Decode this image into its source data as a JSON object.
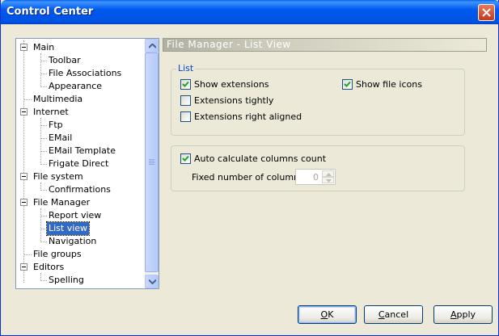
{
  "window": {
    "title": "Control Center"
  },
  "tree": {
    "items": [
      {
        "label": "Main",
        "level": 0,
        "expander": true
      },
      {
        "label": "Toolbar",
        "level": 1
      },
      {
        "label": "File Associations",
        "level": 1
      },
      {
        "label": "Appearance",
        "level": 1
      },
      {
        "label": "Multimedia",
        "level": 0
      },
      {
        "label": "Internet",
        "level": 0,
        "expander": true
      },
      {
        "label": "Ftp",
        "level": 1
      },
      {
        "label": "EMail",
        "level": 1
      },
      {
        "label": "EMail Template",
        "level": 1
      },
      {
        "label": "Frigate Direct",
        "level": 1
      },
      {
        "label": "File system",
        "level": 0,
        "expander": true
      },
      {
        "label": "Confirmations",
        "level": 1
      },
      {
        "label": "File Manager",
        "level": 0,
        "expander": true
      },
      {
        "label": "Report view",
        "level": 1
      },
      {
        "label": "List view",
        "level": 1,
        "selected": true
      },
      {
        "label": "Navigation",
        "level": 1
      },
      {
        "label": "File groups",
        "level": 0
      },
      {
        "label": "Editors",
        "level": 0,
        "expander": true
      },
      {
        "label": "Spelling",
        "level": 1
      }
    ]
  },
  "panel": {
    "header": "File Manager - List View",
    "list_group": {
      "caption": "List",
      "show_extensions": {
        "label": "Show extensions",
        "checked": true
      },
      "show_file_icons": {
        "label": "Show file icons",
        "checked": true
      },
      "extensions_tightly": {
        "label": "Extensions tightly",
        "checked": false
      },
      "extensions_right_aligned": {
        "label": "Extensions right aligned",
        "checked": false
      }
    },
    "columns_group": {
      "auto_calculate": {
        "label": "Auto calculate columns count",
        "checked": true
      },
      "fixed_label": "Fixed number of columns:",
      "fixed_value": "0"
    }
  },
  "buttons": {
    "ok": {
      "accel": "O",
      "rest": "K"
    },
    "cancel": {
      "accel": "C",
      "rest": "ancel"
    },
    "apply": {
      "accel": "A",
      "rest": "pply"
    }
  },
  "colors": {
    "title_bar": "#0054E3",
    "selection": "#316AC5",
    "group_caption": "#0046D5",
    "checkmark": "#21A121"
  }
}
